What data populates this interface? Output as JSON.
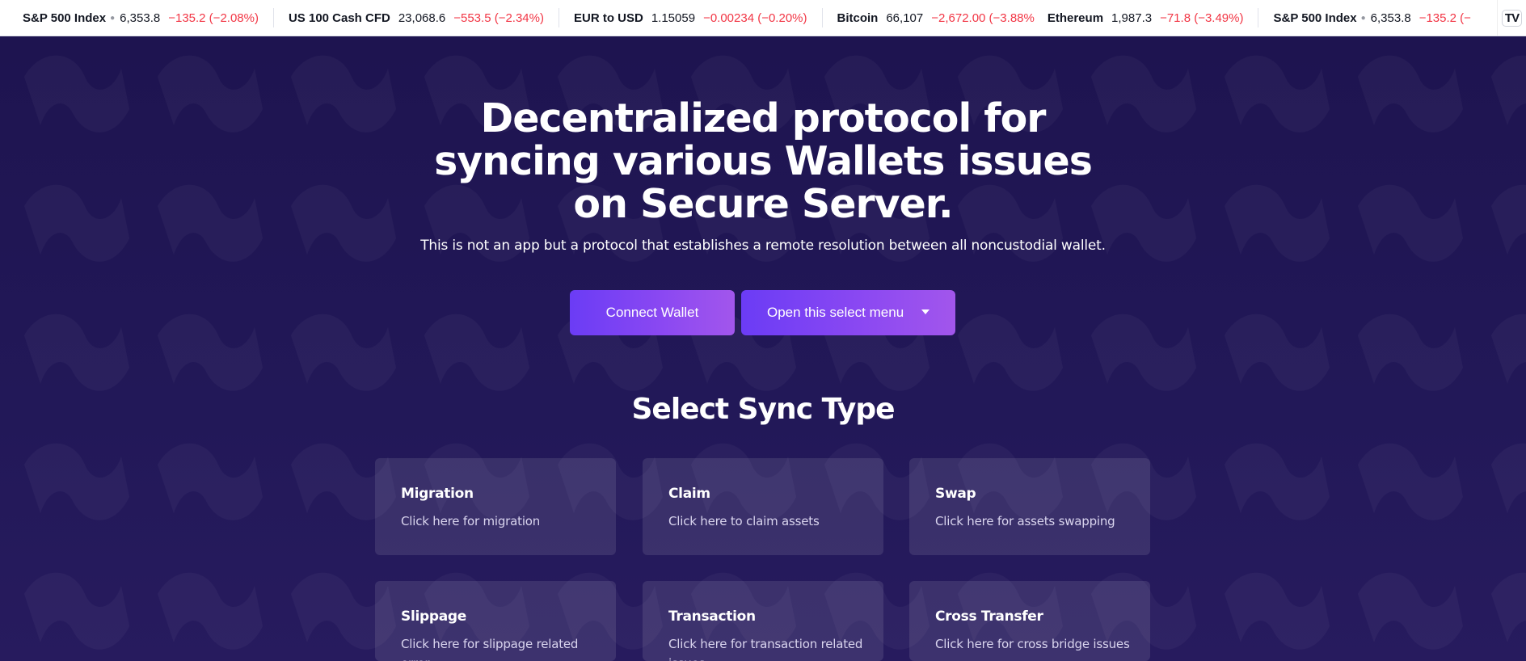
{
  "ticker": {
    "items": [
      {
        "name": "S&P 500 Index",
        "has_dot": true,
        "price": "6,353.8",
        "change": "−135.2 (−2.08%)"
      },
      {
        "name": "US 100 Cash CFD",
        "has_dot": false,
        "price": "23,068.6",
        "change": "−553.5 (−2.34%)"
      },
      {
        "name": "EUR to USD",
        "has_dot": false,
        "price": "1.15059",
        "change": "−0.00234 (−0.20%)"
      },
      {
        "name": "Bitcoin",
        "has_dot": false,
        "price": "66,107",
        "change": "−2,672.00 (−3.88%"
      },
      {
        "name": "Ethereum",
        "has_dot": false,
        "price": "1,987.3",
        "change": "−71.8 (−3.49%)"
      },
      {
        "name": "S&P 500 Index",
        "has_dot": true,
        "price": "6,353.8",
        "change": "−135.2 (−"
      }
    ],
    "logo_text": "TV"
  },
  "hero": {
    "title": "Decentralized protocol for syncing various Wallets issues on Secure Server.",
    "subtitle": "This is not an app but a protocol that establishes a remote resolution between all noncustodial wallet."
  },
  "buttons": {
    "connect_label": "Connect Wallet",
    "select_label": "Open this select menu"
  },
  "section": {
    "title": "Select Sync Type"
  },
  "cards": [
    {
      "title": "Migration",
      "desc": "Click here for migration"
    },
    {
      "title": "Claim",
      "desc": "Click here to claim assets"
    },
    {
      "title": "Swap",
      "desc": "Click here for assets swapping"
    },
    {
      "title": "Slippage",
      "desc": "Click here for slippage related error"
    },
    {
      "title": "Transaction",
      "desc": "Click here for transaction related issues"
    },
    {
      "title": "Cross Transfer",
      "desc": "Click here for cross bridge issues"
    }
  ],
  "colors": {
    "background": "#1f1551",
    "button_gradient_start": "#6b3cf5",
    "button_gradient_end": "#a256ec",
    "ticker_negative": "#f23645"
  }
}
